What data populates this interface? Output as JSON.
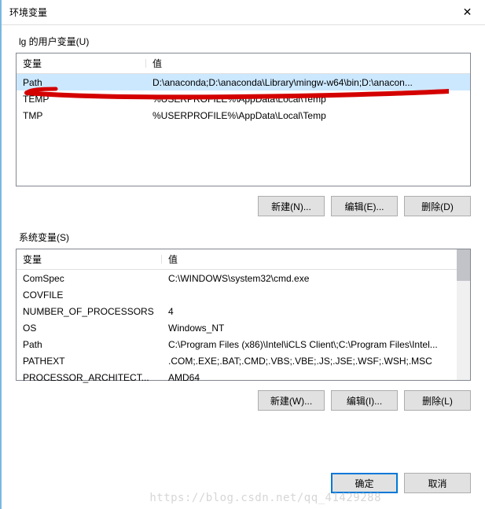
{
  "window": {
    "title": "环境变量",
    "close": "✕"
  },
  "user_section": {
    "label": "lg 的用户变量(U)",
    "col_name": "变量",
    "col_value": "值",
    "rows": [
      {
        "name": "Path",
        "value": "D:\\anaconda;D:\\anaconda\\Library\\mingw-w64\\bin;D:\\anacon..."
      },
      {
        "name": "TEMP",
        "value": "%USERPROFILE%\\AppData\\Local\\Temp"
      },
      {
        "name": "TMP",
        "value": "%USERPROFILE%\\AppData\\Local\\Temp"
      }
    ],
    "btn_new": "新建(N)...",
    "btn_edit": "编辑(E)...",
    "btn_delete": "删除(D)"
  },
  "system_section": {
    "label": "系统变量(S)",
    "col_name": "变量",
    "col_value": "值",
    "rows": [
      {
        "name": "ComSpec",
        "value": "C:\\WINDOWS\\system32\\cmd.exe"
      },
      {
        "name": "COVFILE",
        "value": ""
      },
      {
        "name": "NUMBER_OF_PROCESSORS",
        "value": "4"
      },
      {
        "name": "OS",
        "value": "Windows_NT"
      },
      {
        "name": "Path",
        "value": "C:\\Program Files (x86)\\Intel\\iCLS Client\\;C:\\Program Files\\Intel..."
      },
      {
        "name": "PATHEXT",
        "value": ".COM;.EXE;.BAT;.CMD;.VBS;.VBE;.JS;.JSE;.WSF;.WSH;.MSC"
      },
      {
        "name": "PROCESSOR_ARCHITECT...",
        "value": "AMD64"
      }
    ],
    "btn_new": "新建(W)...",
    "btn_edit": "编辑(I)...",
    "btn_delete": "删除(L)"
  },
  "dialog_buttons": {
    "ok": "确定",
    "cancel": "取消"
  },
  "watermark": "https://blog.csdn.net/qq_41429288"
}
